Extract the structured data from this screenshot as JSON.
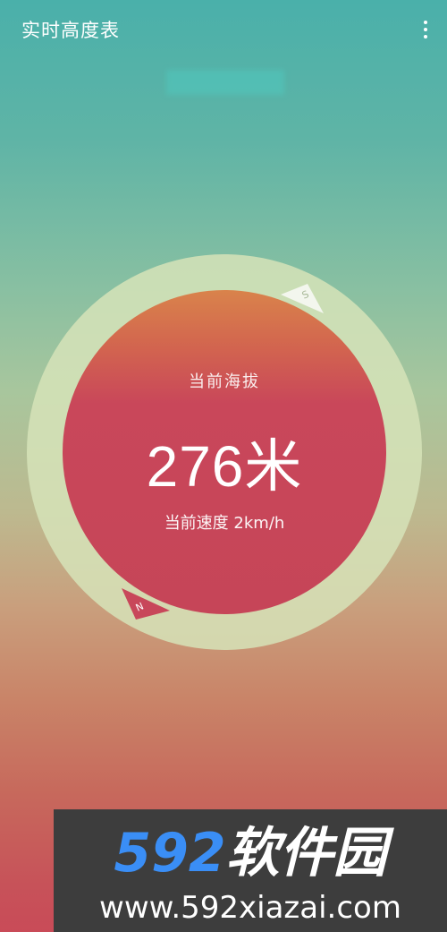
{
  "appbar": {
    "title": "实时高度表",
    "menu_icon": "more-vert-icon"
  },
  "gauge": {
    "altitude_label": "当前海拔",
    "altitude_value": "276米",
    "speed_line": "当前速度 2km/h",
    "compass_north_label": "N",
    "compass_south_label": "S",
    "colors": {
      "ring": "#d6e3b9",
      "disc_top": "#d9834b",
      "disc_main": "#c9475a",
      "north_pointer": "#c8475a",
      "south_pointer": "#f3f6ee"
    }
  },
  "watermark": {
    "brand_number": "592",
    "brand_text": "软件园",
    "url": "www.592xiazai.com",
    "colors": {
      "background": "#3d3d3d",
      "number": "#3a8ef6"
    }
  }
}
